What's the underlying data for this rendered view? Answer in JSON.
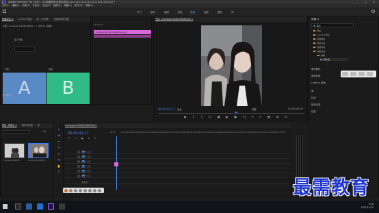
{
  "titlebar": {
    "title": "Adobe Premiere Pro 2020 - D:\\视频制作\\未命名项目\\1212121212121212121212121212 *",
    "window_buttons": "– ▢ ✕"
  },
  "menubar": {
    "items": [
      "文件(F)",
      "编辑(E)",
      "剪辑(C)",
      "序列(S)",
      "标记(M)",
      "图形(G)",
      "视图(V)",
      "窗口(W)",
      "帮助(H)"
    ]
  },
  "workspaces": {
    "items": [
      "学习",
      "组件",
      "编辑",
      "颜色",
      "效果",
      "音频",
      "图形",
      "库"
    ],
    "active_index": 4
  },
  "effect_controls": {
    "tabs": [
      "效果控件 ≡",
      "Lumetri 范围",
      "源：(无剪辑)",
      "音频剪辑混合器"
    ],
    "source_label": "主要 * mmexport1636799483... ＞ 序列 01 (复制)",
    "row1": "插入转场",
    "row2_left": "开始：",
    "row2_right": "结束：",
    "a_label": "A",
    "b_label": "B",
    "bottom_row": "显示实际源"
  },
  "clip_panel": {
    "header": "00:00:00",
    "clip_name": "mmexport1636799483526.jpg"
  },
  "program_monitor": {
    "tab": "节目: mmexport1636799483526 ≡",
    "timecode_left": "00:00:02:17",
    "fit": "适合",
    "full": "完整",
    "timecode_right": "00:00:05:00",
    "transport": [
      "◆",
      "{",
      "}",
      "|←",
      "◀|",
      "▶",
      "|▶",
      "→|",
      "⇥",
      "⇤",
      "📷",
      "⊞",
      "⊟"
    ]
  },
  "effects_panel": {
    "title": "效果 ≡",
    "search_placeholder": "🔍 戴纹",
    "tree": [
      {
        "label": "预设",
        "level": 1
      },
      {
        "label": "Lumetri 预设",
        "level": 1
      },
      {
        "label": "音频效果",
        "level": 1
      },
      {
        "label": "音频过渡",
        "level": 1
      },
      {
        "label": "视频效果",
        "level": 1
      },
      {
        "label": "视频过渡",
        "level": 1
      },
      {
        "label": "擦除",
        "level": 2
      },
      {
        "label": "百叶窗",
        "level": 3
      }
    ],
    "sections": [
      "基本图形",
      "基本声音",
      "Lumetri 颜色",
      "库",
      "标记",
      "历史记录",
      "信息"
    ]
  },
  "project_panel": {
    "tabs": [
      "项目: 未命名 ≡",
      "媒体浏览器",
      "库"
    ],
    "item_count": "2 项",
    "items": [
      {
        "name": "mmexport163679...",
        "duration": "5:00"
      },
      {
        "name": "mmexport163679...",
        "duration": "5:00"
      }
    ]
  },
  "timeline": {
    "tab": "mmexport1636799483526 ≡",
    "timecode": "00:00:02:17",
    "ruler": [
      "00:00",
      "00:00:05:00",
      "00:00:10:00",
      "00:00:15:00",
      "00:00:20:00",
      "00:00:25:00",
      "00:00:30:00",
      "00:00:35:00",
      "00:00:40:00",
      "00:00:45:00",
      "00:00:50:00",
      "00:00:55:00",
      "00:01:00:00",
      "00:01:05:00",
      "00:01:10:00",
      "00:01:15:00"
    ],
    "tracks": [
      {
        "name": "V3",
        "label": "V3"
      },
      {
        "name": "V2",
        "label": "V2"
      },
      {
        "name": "V1",
        "label": "V1"
      },
      {
        "name": "A1",
        "label": "A1"
      },
      {
        "name": "A2",
        "label": "A2"
      },
      {
        "name": "A3",
        "label": "A3"
      },
      {
        "name": "主声道",
        "label": "主声道"
      }
    ]
  },
  "taskbar": {
    "time": "9:18",
    "date": "2021/11/15"
  },
  "watermark": "最需教育",
  "colors": {
    "accent": "#3b78ff",
    "clip": "#d768d7",
    "a_box": "#5a8ac6",
    "b_box": "#2fba87",
    "watermark": "#2238ce"
  }
}
